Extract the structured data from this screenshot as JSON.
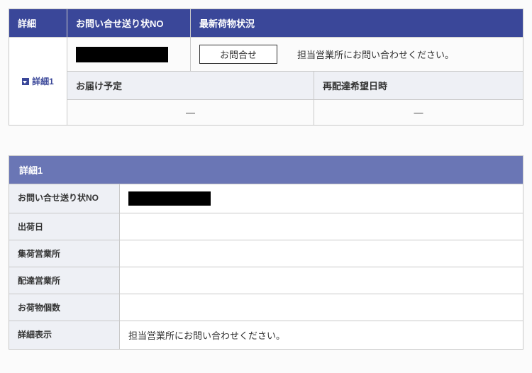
{
  "top": {
    "headers": {
      "detail": "詳細",
      "tracking_no": "お問い合せ送り状NO",
      "latest_status": "最新荷物状況",
      "delivery_plan": "お届け予定",
      "redelivery_request": "再配達希望日時"
    },
    "detail_link": "詳細1",
    "inquiry_button": "お問合せ",
    "status_message": "担当営業所にお問い合わせください。",
    "delivery_plan_value": "—",
    "redelivery_value": "—"
  },
  "detail": {
    "panel_title": "詳細1",
    "labels": {
      "tracking_no": "お問い合せ送り状NO",
      "ship_date": "出荷日",
      "pickup_office": "集荷営業所",
      "delivery_office": "配達営業所",
      "package_count": "お荷物個数",
      "detail_display": "詳細表示"
    },
    "values": {
      "ship_date": "",
      "pickup_office": "",
      "delivery_office": "",
      "package_count": "",
      "detail_display": "担当営業所にお問い合わせください。"
    }
  }
}
